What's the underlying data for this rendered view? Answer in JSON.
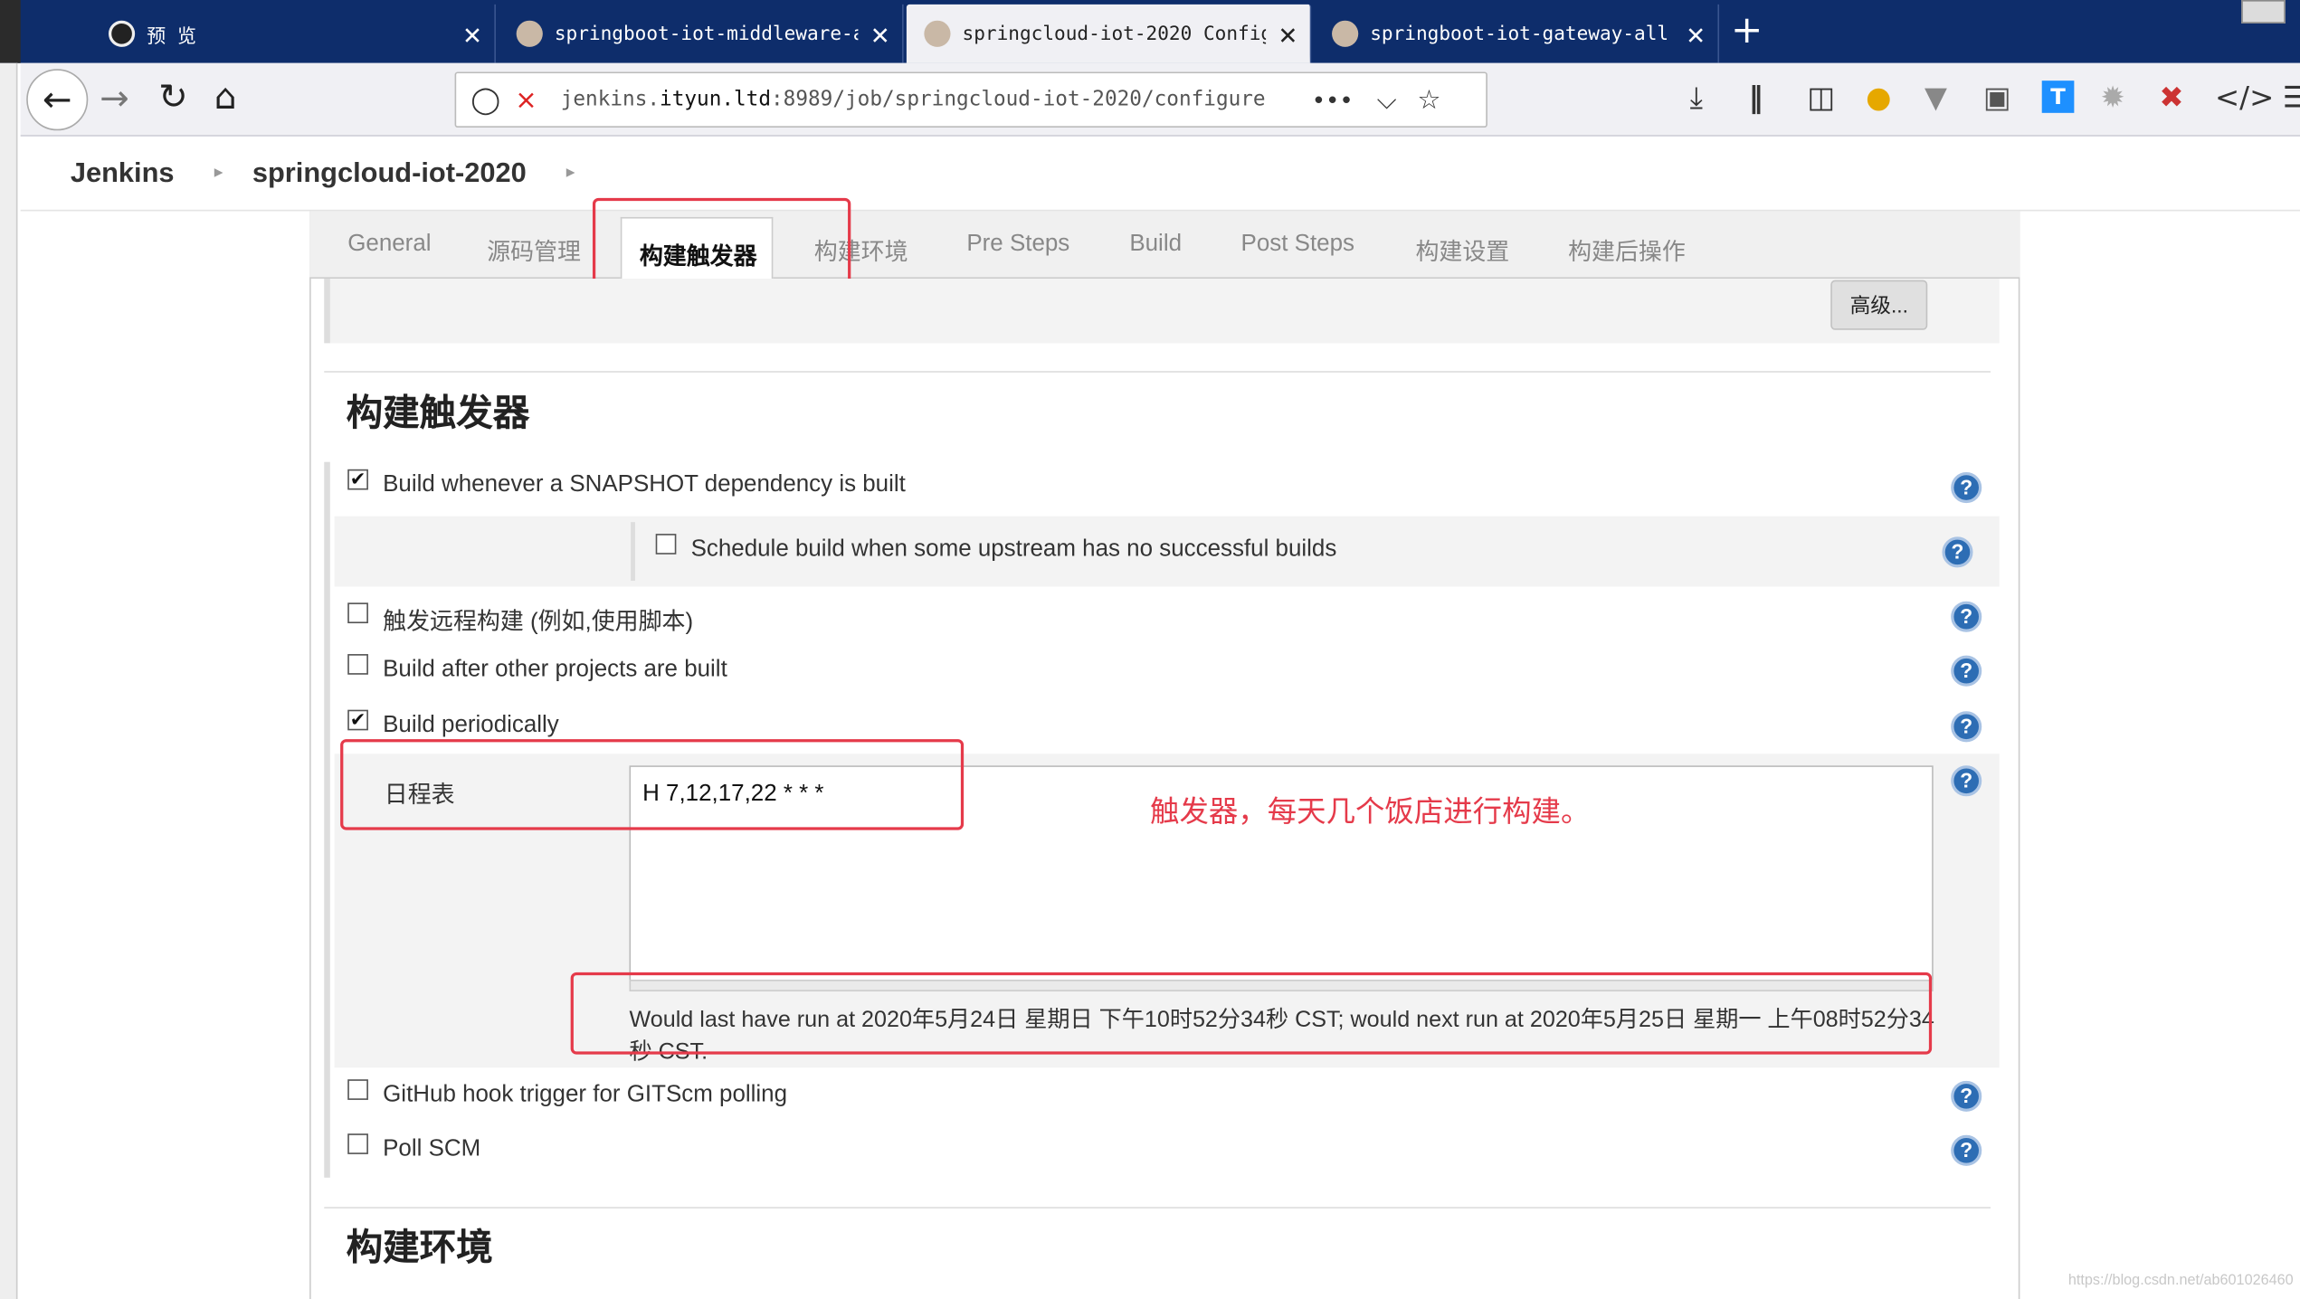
{
  "browser": {
    "tabs": [
      {
        "label": "预 览",
        "active": false
      },
      {
        "label": "springboot-iot-middleware-al",
        "active": false
      },
      {
        "label": "springcloud-iot-2020 Config",
        "active": true
      },
      {
        "label": "springboot-iot-gateway-all",
        "active": false
      }
    ],
    "new_tab": "+",
    "close_glyph": "✕",
    "url_prefix": "jenkins.",
    "url_host": "ityun.ltd",
    "url_rest": ":8989/job/springcloud-iot-2020/configure",
    "url_more": "•••"
  },
  "jenkins": {
    "crumbs": [
      "Jenkins",
      "springcloud-iot-2020"
    ]
  },
  "config_tabs": [
    "General",
    "源码管理",
    "构建触发器",
    "构建环境",
    "Pre Steps",
    "Build",
    "Post Steps",
    "构建设置",
    "构建后操作"
  ],
  "advanced_button": "高级...",
  "section_triggers": "构建触发器",
  "triggers": [
    {
      "label": "Build whenever a SNAPSHOT dependency is built",
      "checked": true
    },
    {
      "label": "Schedule build when some upstream has no successful builds",
      "checked": false
    },
    {
      "label": "触发远程构建 (例如,使用脚本)",
      "checked": false
    },
    {
      "label": "Build after other projects are built",
      "checked": false
    },
    {
      "label": "Build periodically",
      "checked": true
    },
    {
      "label": "GitHub hook trigger for GITScm polling",
      "checked": false
    },
    {
      "label": "Poll SCM",
      "checked": false
    }
  ],
  "schedule_label": "日程表",
  "schedule_value": "H 7,12,17,22 * * *",
  "annotation": "触发器，每天几个饭店进行构建。",
  "schedule_preview": "Would last have run at 2020年5月24日 星期日 下午10时52分34秒 CST; would next run at 2020年5月25日 星期一 上午08时52分34秒 CST.",
  "section_env": "构建环境",
  "watermark": "https://blog.csdn.net/ab601026460"
}
